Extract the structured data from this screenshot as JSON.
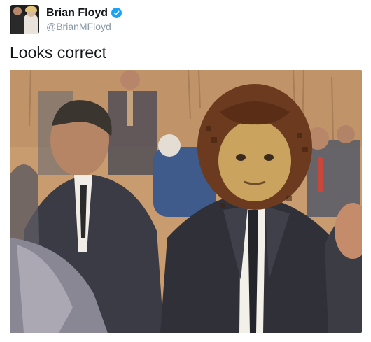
{
  "tweet": {
    "author": {
      "display_name": "Brian Floyd",
      "handle": "@BrianMFloyd",
      "verified": true,
      "verified_icon": "verified-badge-icon"
    },
    "text": "Looks correct"
  },
  "colors": {
    "verified_blue": "#1da1f2",
    "handle_gray": "#8899a6",
    "text": "#14171a"
  }
}
